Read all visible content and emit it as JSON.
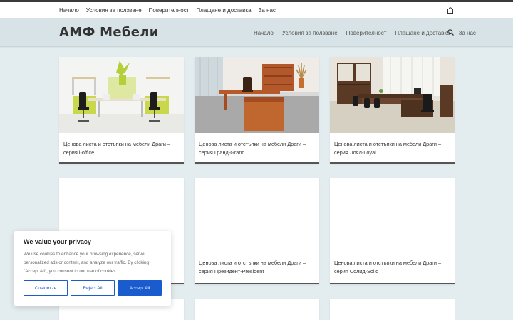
{
  "topbar": {
    "nav": [
      "Начало",
      "Условия за ползване",
      "Поверителност",
      "Плащане и доставка",
      "За нас"
    ]
  },
  "header": {
    "logo": "АМФ Мебели",
    "nav": [
      "Начало",
      "Условия за ползване",
      "Поверителност",
      "Плащане и доставка",
      "За нас"
    ]
  },
  "cards": [
    {
      "line1": "Ценова листа и отстъпки на мебели Драги –",
      "line2": "серия i-office"
    },
    {
      "line1": "Ценова листа и отстъпки на мебели Драги –",
      "line2": "серия Гранд-Grand"
    },
    {
      "line1": "Ценова листа и отстъпки на мебели Драги –",
      "line2": "серия Лоял-Loyal"
    },
    {
      "line1": "",
      "line2": ""
    },
    {
      "line1": "Ценова листа и отстъпки на мебели Драги –",
      "line2": "серия Президент-President"
    },
    {
      "line1": "Ценова листа и отстъпки на мебели Драги –",
      "line2": "серия Солид-Solid"
    }
  ],
  "cookie": {
    "title": "We value your privacy",
    "text": "We use cookies to enhance your browsing experience, serve personalized ads or content, and analyze our traffic. By clicking \"Accept All\", you consent to our use of cookies.",
    "customize": "Customize",
    "reject": "Reject All",
    "accept": "Accept All"
  },
  "colors": {
    "accent": "#1a5cce",
    "background": "#e3ecee",
    "header": "#d7e3e6"
  }
}
